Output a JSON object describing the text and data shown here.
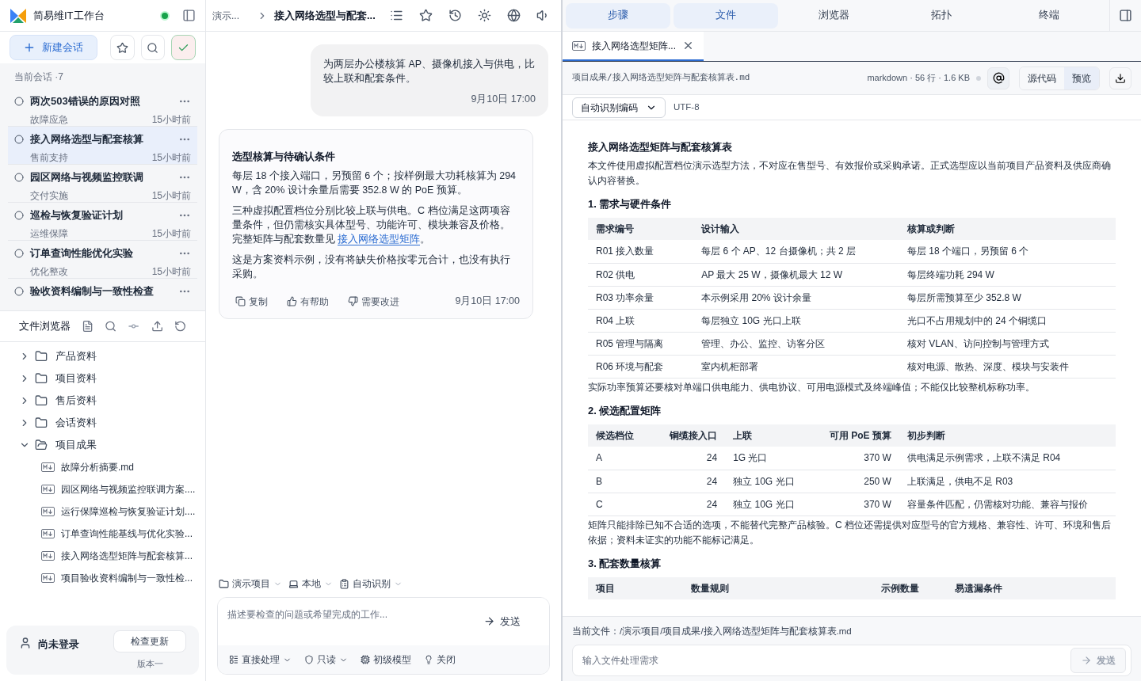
{
  "app": {
    "title": "简易维IT工作台",
    "connected": true
  },
  "sidebar": {
    "new_chat": "新建会话",
    "section_label": "当前会话 ·7",
    "sessions": [
      {
        "title": "两次503错误的原因对照",
        "category": "故障应急",
        "time": "15小时前",
        "selected": false
      },
      {
        "title": "接入网络选型与配套核算",
        "category": "售前支持",
        "time": "15小时前",
        "selected": true
      },
      {
        "title": "园区网络与视频监控联调",
        "category": "交付实施",
        "time": "15小时前",
        "selected": false
      },
      {
        "title": "巡检与恢复验证计划",
        "category": "运维保障",
        "time": "15小时前",
        "selected": false
      },
      {
        "title": "订单查询性能优化实验",
        "category": "优化整改",
        "time": "15小时前",
        "selected": false
      },
      {
        "title": "验收资料编制与一致性检查",
        "selected": false
      }
    ],
    "file_browser": {
      "title": "文件浏览器",
      "tree": [
        {
          "kind": "folder",
          "name": "产品资料",
          "expanded": false
        },
        {
          "kind": "folder",
          "name": "项目资料",
          "expanded": false
        },
        {
          "kind": "folder",
          "name": "售后资料",
          "expanded": false
        },
        {
          "kind": "folder",
          "name": "会话资料",
          "expanded": false
        },
        {
          "kind": "folder",
          "name": "项目成果",
          "expanded": true,
          "children": [
            {
              "kind": "file",
              "name": "故障分析摘要.md"
            },
            {
              "kind": "file",
              "name": "园区网络与视频监控联调方案...."
            },
            {
              "kind": "file",
              "name": "运行保障巡检与恢复验证计划...."
            },
            {
              "kind": "file",
              "name": "订单查询性能基线与优化实验..."
            },
            {
              "kind": "file",
              "name": "接入网络选型矩阵与配套核算..."
            },
            {
              "kind": "file",
              "name": "项目验收资料编制与一致性检..."
            }
          ]
        }
      ]
    },
    "account": {
      "user": "尚未登录",
      "update_button": "检查更新",
      "version": "版本一"
    }
  },
  "chat": {
    "breadcrumb": [
      "演示...",
      "接入网络选型与配套..."
    ],
    "messages": [
      {
        "kind": "user",
        "paragraphs": [
          {
            "text": "为两层办公楼核算 AP、摄像机接入与供电，比较上联和配套条件。"
          }
        ],
        "time": "9月10日 17:00"
      },
      {
        "kind": "assistant",
        "title": "选型核算与待确认条件",
        "paragraphs": [
          {
            "text": "每层 18 个接入端口，另预留 6 个；按样例最大功耗核算为 294 W，含 20% 设计余量后需要 352.8 W 的 PoE 预算。"
          },
          {
            "text": "三种虚拟配置档位分别比较上联与供电。C 档位满足这两项容量条件，但仍需核实具体型号、功能许可、模块兼容及价格。完整矩阵与配套数量见 ",
            "link": "接入网络选型矩阵",
            "after": "。"
          },
          {
            "text": "这是方案资料示例，没有将缺失价格按零元合计，也没有执行采购。"
          }
        ],
        "actions": [
          "复制",
          "有帮助",
          "需要改进"
        ],
        "time": "9月10日 17:00"
      }
    ],
    "context": [
      "演示项目",
      "本地",
      "自动识别"
    ],
    "input": {
      "placeholder": "描述要检查的问题或希望完成的工作...",
      "send": "发送"
    },
    "options": [
      "直接处理",
      "只读",
      "初级模型",
      "关闭"
    ]
  },
  "panel": {
    "tabs": [
      {
        "label": "步骤",
        "selected": true
      },
      {
        "label": "文件",
        "selected": true
      },
      {
        "label": "浏览器",
        "selected": false
      },
      {
        "label": "拓扑",
        "selected": false
      },
      {
        "label": "终端",
        "selected": false
      }
    ],
    "file_tab": "接入网络选型矩阵...",
    "path": "项目成果/接入网络选型矩阵与配套核算表.md",
    "meta": "markdown · 56 行 · 1.6 KB",
    "view_modes": [
      {
        "label": "源代码",
        "selected": false
      },
      {
        "label": "预览",
        "selected": true
      }
    ],
    "encoding": {
      "value": "自动识别编码",
      "detected": "UTF-8"
    },
    "doc": [
      {
        "kind": "h1",
        "text": "接入网络选型矩阵与配套核算表"
      },
      {
        "kind": "p",
        "text": "本文件使用虚拟配置档位演示选型方法，不对应在售型号、有效报价或采购承诺。正式选型应以当前项目产品资料及供应商确认内容替换。"
      },
      {
        "kind": "h2",
        "text": "1. 需求与硬件条件"
      },
      {
        "kind": "table",
        "columns": [
          {
            "label": "需求编号"
          },
          {
            "label": "设计输入"
          },
          {
            "label": "核算或判断"
          }
        ],
        "rows": [
          [
            "R01 接入数量",
            "每层 6 个 AP、12 台摄像机；共 2 层",
            "每层 18 个端口，另预留 6 个"
          ],
          [
            "R02 供电",
            "AP 最大 25 W，摄像机最大 12 W",
            "每层终端功耗 294 W"
          ],
          [
            "R03 功率余量",
            "本示例采用 20% 设计余量",
            "每层所需预算至少 352.8 W"
          ],
          [
            "R04 上联",
            "每层独立 10G 光口上联",
            "光口不占用规划中的 24 个铜缆口"
          ],
          [
            "R05 管理与隔离",
            "管理、办公、监控、访客分区",
            "核对 VLAN、访问控制与管理方式"
          ],
          [
            "R06 环境与配套",
            "室内机柜部署",
            "核对电源、散热、深度、模块与安装件"
          ]
        ]
      },
      {
        "kind": "p",
        "text": "实际功率预算还要核对单端口供电能力、供电协议、可用电源模式及终端峰值；不能仅比较整机标称功率。"
      },
      {
        "kind": "h2",
        "text": "2. 候选配置矩阵"
      },
      {
        "kind": "table",
        "columns": [
          {
            "label": "候选档位"
          },
          {
            "label": "铜缆接入口",
            "kind": "number"
          },
          {
            "label": "上联"
          },
          {
            "label": "可用 PoE 预算",
            "kind": "number"
          },
          {
            "label": "初步判断"
          }
        ],
        "rows": [
          [
            "A",
            "24",
            "1G 光口",
            "370 W",
            "供电满足示例需求，上联不满足 R04"
          ],
          [
            "B",
            "24",
            "独立 10G 光口",
            "250 W",
            "上联满足，供电不足 R03"
          ],
          [
            "C",
            "24",
            "独立 10G 光口",
            "370 W",
            "容量条件匹配，仍需核对功能、兼容与报价"
          ]
        ]
      },
      {
        "kind": "p",
        "text": "矩阵只能排除已知不合适的选项，不能替代完整产品核验。C 档位还需提供对应型号的官方规格、兼容性、许可、环境和售后依据；资料未证实的功能不能标记满足。"
      },
      {
        "kind": "h2",
        "text": "3. 配套数量核算"
      },
      {
        "kind": "table",
        "columns": [
          {
            "label": "项目"
          },
          {
            "label": "数量规则"
          },
          {
            "label": "示例数量"
          },
          {
            "label": "易遗漏条件"
          }
        ]
      }
    ],
    "current_file": "当前文件：/演示项目/项目成果/接入网络选型矩阵与配套核算表.md",
    "input": {
      "placeholder": "输入文件处理需求",
      "send": "发送",
      "disabled": true
    }
  }
}
